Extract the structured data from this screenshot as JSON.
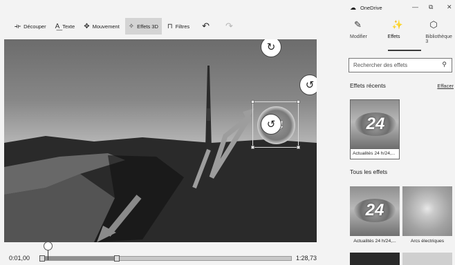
{
  "toolbar": {
    "items": [
      {
        "icon": "trim-icon",
        "glyph": "⟛",
        "label": "Découper"
      },
      {
        "icon": "text-icon",
        "glyph": "A͟",
        "label": "Texte"
      },
      {
        "icon": "motion-icon",
        "glyph": "✥",
        "label": "Mouvement"
      },
      {
        "icon": "effects-3d-icon",
        "glyph": "✧",
        "label": "Effets 3D"
      },
      {
        "icon": "filters-icon",
        "glyph": "⊓",
        "label": "Filtres"
      }
    ],
    "undo_glyph": "↶",
    "redo_glyph": "↷"
  },
  "preview": {
    "effect_text": "24",
    "rotate_top_glyph": "↻",
    "rotate_right_glyph": "↺",
    "rotate_bottom_glyph": "↺"
  },
  "timeline": {
    "time_start": "0:01,00",
    "time_end": "1:28,73",
    "selection_fraction": 0.305,
    "trim_glyph": "‖"
  },
  "panel": {
    "app_title": "OneDrive",
    "window_controls": {
      "minimize": "—",
      "restore": "⧉",
      "close": "✕"
    },
    "tabs": [
      {
        "icon": "pencil-icon",
        "glyph": "✎",
        "label": "Modifier"
      },
      {
        "icon": "sparkle-icon",
        "glyph": "✨",
        "label": "Effets"
      },
      {
        "icon": "cube-icon",
        "glyph": "⬡",
        "label": "Bibliothèque 3"
      }
    ],
    "search_placeholder": "Rechercher des effets",
    "search_glyph": "⚲",
    "recent_heading": "Effets récents",
    "clear_label": "Effacer",
    "recent_effects": [
      {
        "label": "Actualités 24 h/24,...",
        "thumb_text": "24"
      }
    ],
    "all_heading": "Tous les effets",
    "all_effects": [
      {
        "label": "Actualités 24 h/24,...",
        "thumb_text": "24"
      },
      {
        "label": "Arcs électriques"
      }
    ]
  }
}
